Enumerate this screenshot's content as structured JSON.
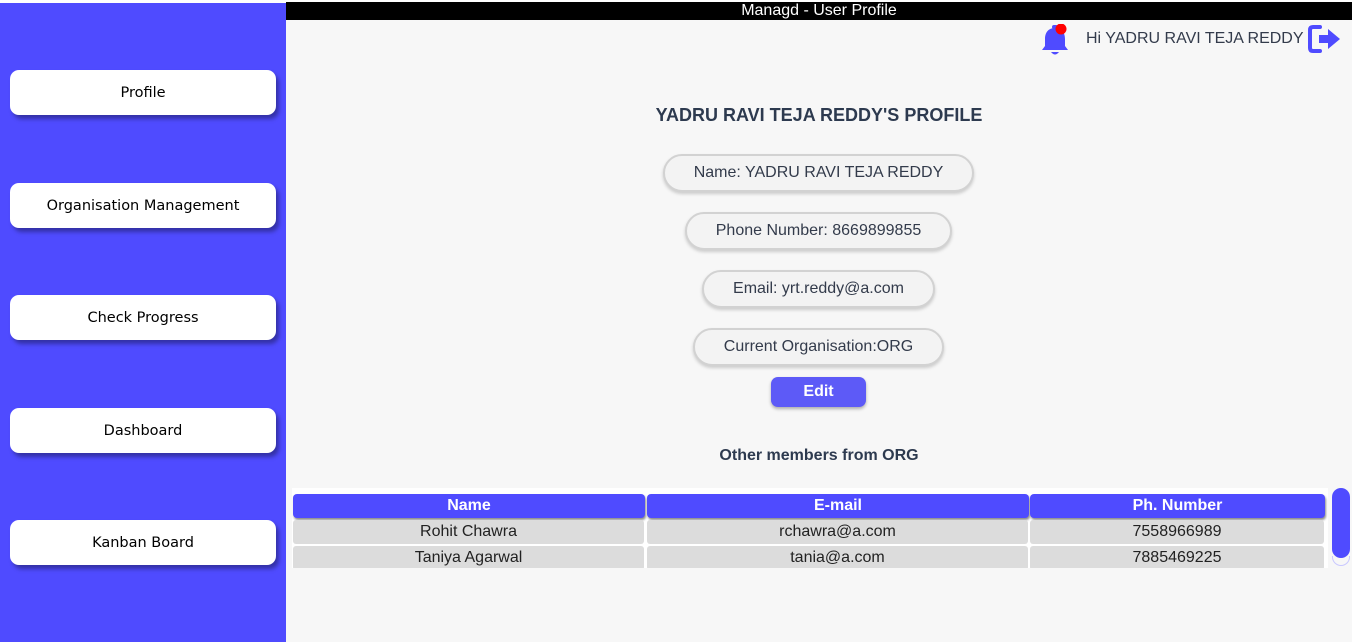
{
  "app": {
    "title": "Managd - User Profile"
  },
  "colors": {
    "sidebar": "#4f4bff",
    "accent": "#5d5af7",
    "notification_dot": "#ff0000",
    "text": "#333b4b"
  },
  "sidebar": {
    "items": [
      {
        "label": "Profile"
      },
      {
        "label": "Organisation Management"
      },
      {
        "label": "Check Progress"
      },
      {
        "label": "Dashboard"
      },
      {
        "label": "Kanban Board"
      }
    ]
  },
  "header": {
    "greeting": "Hi YADRU RAVI TEJA REDDY",
    "icons": {
      "notification": "bell-icon",
      "logout": "logout-icon"
    }
  },
  "profile": {
    "title": "YADRU RAVI TEJA REDDY'S PROFILE",
    "name": "Name: YADRU RAVI TEJA REDDY",
    "phone": "Phone Number: 8669899855",
    "email": "Email: yrt.reddy@a.com",
    "organisation": "Current Organisation:ORG",
    "edit_label": "Edit"
  },
  "members": {
    "title": "Other members from ORG",
    "columns": [
      "Name",
      "E-mail",
      "Ph. Number"
    ],
    "rows": [
      [
        "Rohit Chawra",
        "rchawra@a.com",
        "7558966989"
      ],
      [
        "Taniya Agarwal",
        "tania@a.com",
        "7885469225"
      ]
    ]
  }
}
